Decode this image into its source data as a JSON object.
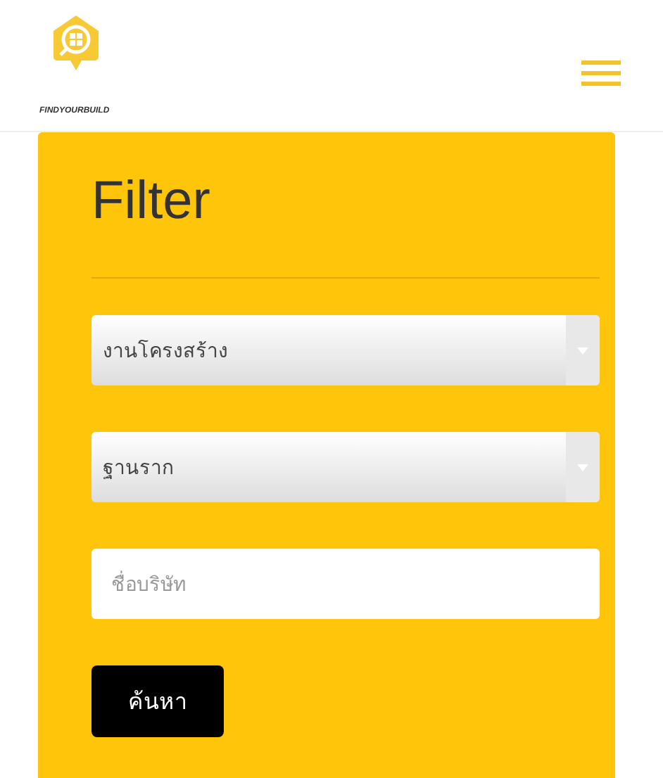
{
  "header": {
    "logo_text": "FINDYOURBUILD"
  },
  "filter": {
    "title": "Filter",
    "selects": [
      {
        "value": "งานโครงสร้าง"
      },
      {
        "value": "ฐานราก"
      }
    ],
    "company_field": {
      "placeholder": "ชื่อบริษัท"
    },
    "search_button": "ค้นหา"
  }
}
